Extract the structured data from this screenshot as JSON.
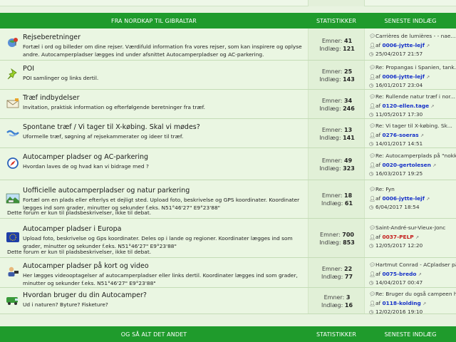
{
  "header_top": {
    "forum_col": "FRA NORDKAP TIL GIBRALTAR",
    "stats_col": "STATISTIKKER",
    "last_col": "SENESTE INDLÆG"
  },
  "header_bottom": {
    "forum_col": "OG SÅ ALT DET ANDET",
    "stats_col": "STATISTIKKER",
    "last_col": "SENESTE INDLÆG"
  },
  "colors": {
    "header": "#1f9b2c",
    "row_bg": "#eaf6e2",
    "user_link": "#1530c8",
    "user_red": "#c41a1a"
  },
  "forums": [
    {
      "icon": "globe-pin-icon",
      "title": "Rejseberetninger",
      "desc": "Fortæl i ord og billeder om dine rejser. Værdifuld information fra vores rejser, som kan inspirere og oplyse andre. Autocamperpladser lægges ind under afsnittet Autocamperpladser og AC-parkering.",
      "note": "",
      "topics_label": "Emner:",
      "topics": "41",
      "posts_label": "Indlæg:",
      "posts": "121",
      "last_title": "Carrières de lumières - - nae...",
      "by": "af",
      "last_user": "0006-jytte-lejf",
      "last_user_red": false,
      "last_date": "25/04/2017 21:57"
    },
    {
      "icon": "pushpin-icon",
      "title": "POI",
      "desc": "POI samlinger og links dertil.",
      "note": "",
      "topics_label": "Emner:",
      "topics": "25",
      "posts_label": "Indlæg:",
      "posts": "143",
      "last_title": "Re: Propangas i Spanien, tank...",
      "by": "af",
      "last_user": "0006-jytte-lejf",
      "last_user_red": false,
      "last_date": "16/01/2017 23:04"
    },
    {
      "icon": "envelope-icon",
      "title": "Træf indbydelser",
      "desc": "Invitation, praktisk information og efterfølgende beretninger fra træf.",
      "note": "",
      "topics_label": "Emner:",
      "topics": "34",
      "posts_label": "Indlæg:",
      "posts": "246",
      "last_title": "Re: Rullende natur træf i nor...",
      "by": "af",
      "last_user": "0120-ellen.tage",
      "last_user_red": false,
      "last_date": "11/05/2017 17:30"
    },
    {
      "icon": "handshake-icon",
      "title": "Spontane træf / Vi tager til X-købing. Skal vi mødes?",
      "desc": "Uformelle træf, søgning af rejsekammerater og ideer til træf.",
      "note": "",
      "topics_label": "Emner:",
      "topics": "13",
      "posts_label": "Indlæg:",
      "posts": "141",
      "last_title": "Re: Vi tager til X-købing. Sk...",
      "by": "af",
      "last_user": "0276-soeras",
      "last_user_red": false,
      "last_date": "14/01/2017 14:51"
    },
    {
      "icon": "compass-icon",
      "title": "Autocamper pladser og AC-parkering",
      "desc": "Hvordan laves de og hvad kan vi bidrage med ?",
      "note": "",
      "topics_label": "Emner:",
      "topics": "49",
      "posts_label": "Indlæg:",
      "posts": "323",
      "last_title": "Re: Autocamperplads på \"nokke...",
      "by": "af",
      "last_user": "0020-gertolesen",
      "last_user_red": false,
      "last_date": "16/03/2017 19:25"
    },
    {
      "icon": "landscape-icon",
      "title": "Uofficielle autocamperpladser og natur parkering",
      "desc": "Fortæl om en plads eller efterlys et dejligt sted. Upload foto, beskrivelse og GPS koordinater. Koordinater lægges ind som grader, minutter og sekunder f.eks. N51°46'27\" E9°23'88\"",
      "note": "Dette forum er kun til pladsbeskrivelser, ikke til debat.",
      "topics_label": "Emner:",
      "topics": "18",
      "posts_label": "Indlæg:",
      "posts": "61",
      "last_title": "Re: Fyn",
      "by": "af",
      "last_user": "0006-jytte-lejf",
      "last_user_red": false,
      "last_date": "6/04/2017 18:54"
    },
    {
      "icon": "eu-flag-icon",
      "title": "Autocamper pladser i Europa",
      "desc": "Upload foto, beskrivelse og Gps koordinater. Deles op i lande og regioner. Koordinater lægges ind som grader, minutter og sekunder f.eks. N51°46'27\" E9°23'88\"",
      "note": "Dette forum er kun til pladsbeskrivelser, ikke til debat.",
      "topics_label": "Emner:",
      "topics": "700",
      "posts_label": "Indlæg:",
      "posts": "853",
      "last_title": "Saint-André-sur-Vieux-Jonc",
      "by": "af",
      "last_user": "0037-PELP",
      "last_user_red": true,
      "last_date": "12/05/2017 12:20"
    },
    {
      "icon": "video-person-icon",
      "title": "Autocamper pladser på kort og video",
      "desc": "Her lægges videooptagelser af autocamperpladser eller links dertil. Koordinater lægges ind som grader, minutter og sekunder f.eks. N51°46'27\" E9°23'88\"",
      "note": "",
      "topics_label": "Emner:",
      "topics": "22",
      "posts_label": "Indlæg:",
      "posts": "77",
      "last_title": "Hartmut Conrad - ACpladser på...",
      "by": "af",
      "last_user": "0075-bredo",
      "last_user_red": false,
      "last_date": "14/04/2017 00:47"
    },
    {
      "icon": "camper-icon",
      "title": "Hvordan bruger du din Autocamper?",
      "desc": "Ud i naturen? Byture? Fisketure?",
      "note": "",
      "topics_label": "Emner:",
      "topics": "3",
      "posts_label": "Indlæg:",
      "posts": "16",
      "last_title": "Re: Bruger du også campeen h...",
      "by": "af",
      "last_user": "0118-kolding",
      "last_user_red": false,
      "last_date": "12/02/2016 19:10"
    }
  ]
}
